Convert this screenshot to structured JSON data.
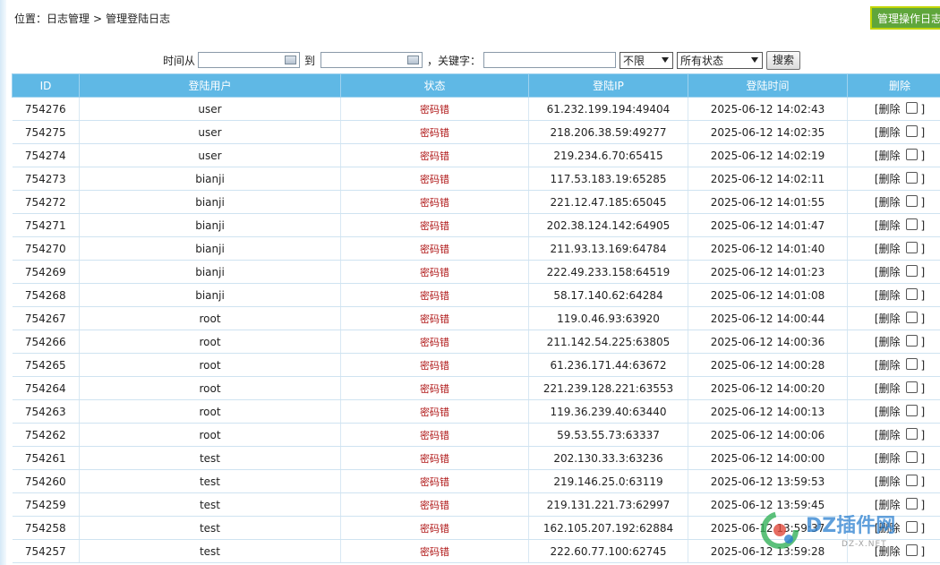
{
  "breadcrumb": {
    "prefix": "位置：",
    "section": "日志管理",
    "separator": ">",
    "current": "管理登陆日志"
  },
  "op_log_button": "管理操作日志",
  "search": {
    "time_from_label": "时间从",
    "to_label": "到",
    "keyword_label": "，关键字：",
    "scope_select": "不限",
    "status_select": "所有状态",
    "search_button": "搜索"
  },
  "table": {
    "headers": [
      "ID",
      "登陆用户",
      "状态",
      "登陆IP",
      "登陆时间",
      "删除"
    ],
    "delete_open": "[删除",
    "delete_close": "]",
    "rows": [
      {
        "id": "754276",
        "user": "user",
        "status": "密码错",
        "ip": "61.232.199.194:49404",
        "time": "2025-06-12 14:02:43"
      },
      {
        "id": "754275",
        "user": "user",
        "status": "密码错",
        "ip": "218.206.38.59:49277",
        "time": "2025-06-12 14:02:35"
      },
      {
        "id": "754274",
        "user": "user",
        "status": "密码错",
        "ip": "219.234.6.70:65415",
        "time": "2025-06-12 14:02:19"
      },
      {
        "id": "754273",
        "user": "bianji",
        "status": "密码错",
        "ip": "117.53.183.19:65285",
        "time": "2025-06-12 14:02:11"
      },
      {
        "id": "754272",
        "user": "bianji",
        "status": "密码错",
        "ip": "221.12.47.185:65045",
        "time": "2025-06-12 14:01:55"
      },
      {
        "id": "754271",
        "user": "bianji",
        "status": "密码错",
        "ip": "202.38.124.142:64905",
        "time": "2025-06-12 14:01:47"
      },
      {
        "id": "754270",
        "user": "bianji",
        "status": "密码错",
        "ip": "211.93.13.169:64784",
        "time": "2025-06-12 14:01:40"
      },
      {
        "id": "754269",
        "user": "bianji",
        "status": "密码错",
        "ip": "222.49.233.158:64519",
        "time": "2025-06-12 14:01:23"
      },
      {
        "id": "754268",
        "user": "bianji",
        "status": "密码错",
        "ip": "58.17.140.62:64284",
        "time": "2025-06-12 14:01:08"
      },
      {
        "id": "754267",
        "user": "root",
        "status": "密码错",
        "ip": "119.0.46.93:63920",
        "time": "2025-06-12 14:00:44"
      },
      {
        "id": "754266",
        "user": "root",
        "status": "密码错",
        "ip": "211.142.54.225:63805",
        "time": "2025-06-12 14:00:36"
      },
      {
        "id": "754265",
        "user": "root",
        "status": "密码错",
        "ip": "61.236.171.44:63672",
        "time": "2025-06-12 14:00:28"
      },
      {
        "id": "754264",
        "user": "root",
        "status": "密码错",
        "ip": "221.239.128.221:63553",
        "time": "2025-06-12 14:00:20"
      },
      {
        "id": "754263",
        "user": "root",
        "status": "密码错",
        "ip": "119.36.239.40:63440",
        "time": "2025-06-12 14:00:13"
      },
      {
        "id": "754262",
        "user": "root",
        "status": "密码错",
        "ip": "59.53.55.73:63337",
        "time": "2025-06-12 14:00:06"
      },
      {
        "id": "754261",
        "user": "test",
        "status": "密码错",
        "ip": "202.130.33.3:63236",
        "time": "2025-06-12 14:00:00"
      },
      {
        "id": "754260",
        "user": "test",
        "status": "密码错",
        "ip": "219.146.25.0:63119",
        "time": "2025-06-12 13:59:53"
      },
      {
        "id": "754259",
        "user": "test",
        "status": "密码错",
        "ip": "219.131.221.73:62997",
        "time": "2025-06-12 13:59:45"
      },
      {
        "id": "754258",
        "user": "test",
        "status": "密码错",
        "ip": "162.105.207.192:62884",
        "time": "2025-06-12 13:59:37"
      },
      {
        "id": "754257",
        "user": "test",
        "status": "密码错",
        "ip": "222.60.77.100:62745",
        "time": "2025-06-12 13:59:28"
      }
    ]
  },
  "watermark": {
    "brand": "DZ插件网",
    "domain": "DZ-X.NET"
  },
  "colors": {
    "header_bg": "#5fb8e5",
    "status_red": "#b01818",
    "op_button_bg": "#5fa63b",
    "op_button_border": "#c2d500"
  }
}
